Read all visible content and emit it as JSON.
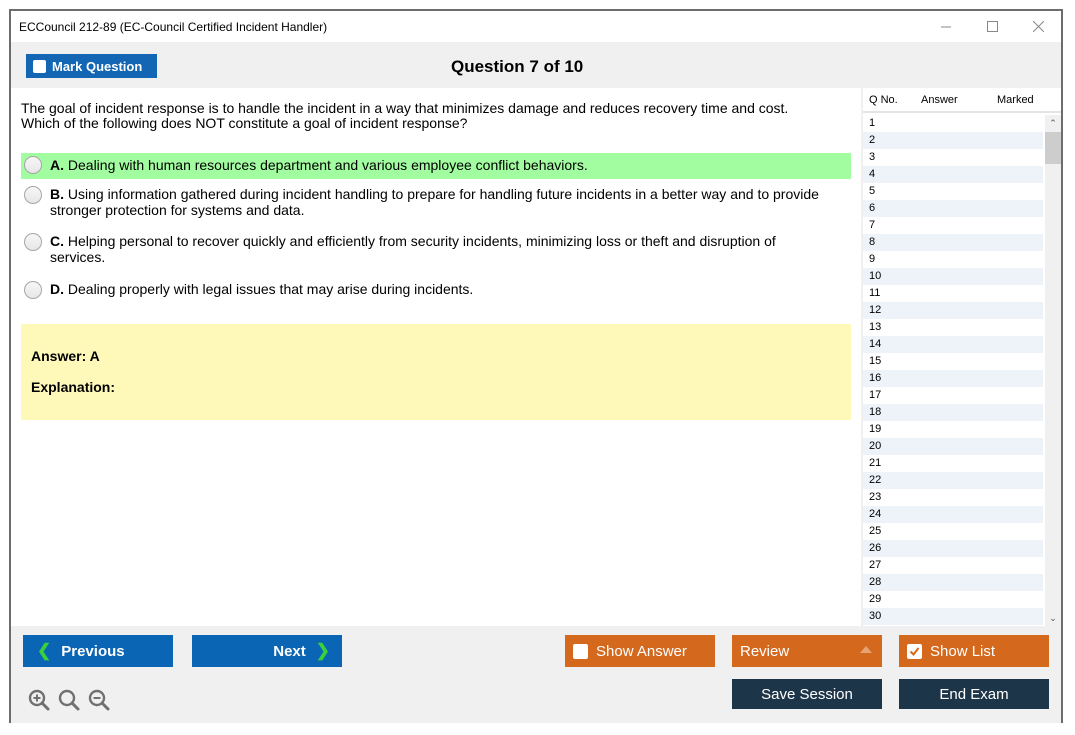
{
  "window": {
    "title": "ECCouncil 212-89 (EC-Council Certified Incident Handler)",
    "controls": {
      "minimize": "minimize-icon",
      "maximize": "maximize-icon",
      "close": "close-icon"
    }
  },
  "toolbar": {
    "mark_question_label": "Mark Question",
    "mark_question_checked": false,
    "question_counter": "Question 7 of 10"
  },
  "question": {
    "text_line1": "The goal of incident response is to handle the incident in a way that minimizes damage and reduces recovery time and cost.",
    "text_line2": "Which of the following does NOT constitute a goal of incident response?",
    "options": [
      {
        "letter": "A.",
        "text": "Dealing with human resources department and various employee conflict behaviors.",
        "highlighted": true
      },
      {
        "letter": "B.",
        "text": "Using information gathered during incident handling to prepare for handling future incidents in a better way and to provide stronger protection for systems and data.",
        "highlighted": false
      },
      {
        "letter": "C.",
        "text": "Helping personal to recover quickly and efficiently from security incidents, minimizing loss or theft and disruption of services.",
        "highlighted": false
      },
      {
        "letter": "D.",
        "text": "Dealing properly with legal issues that may arise during incidents.",
        "highlighted": false
      }
    ],
    "answer_label": "Answer: A",
    "explanation_label": "Explanation:"
  },
  "question_list": {
    "headers": {
      "qno": "Q No.",
      "answer": "Answer",
      "marked": "Marked"
    },
    "rows": [
      "1",
      "2",
      "3",
      "4",
      "5",
      "6",
      "7",
      "8",
      "9",
      "10",
      "11",
      "12",
      "13",
      "14",
      "15",
      "16",
      "17",
      "18",
      "19",
      "20",
      "21",
      "22",
      "23",
      "24",
      "25",
      "26",
      "27",
      "28",
      "29",
      "30"
    ]
  },
  "bottom": {
    "previous_label": "Previous",
    "next_label": "Next",
    "show_answer_label": "Show Answer",
    "show_answer_checked": false,
    "review_label": "Review",
    "show_list_label": "Show List",
    "show_list_checked": true,
    "save_session_label": "Save Session",
    "end_exam_label": "End Exam",
    "zoom_icons": [
      "zoom-in-icon",
      "zoom-reset-icon",
      "zoom-out-icon"
    ]
  },
  "colors": {
    "primary_blue": "#1266b4",
    "orange": "#d4691e",
    "dark_navy": "#1d3549",
    "correct_green": "#a1fd9f",
    "answer_yellow": "#fef8b9",
    "chevron_green": "#38d13c"
  }
}
